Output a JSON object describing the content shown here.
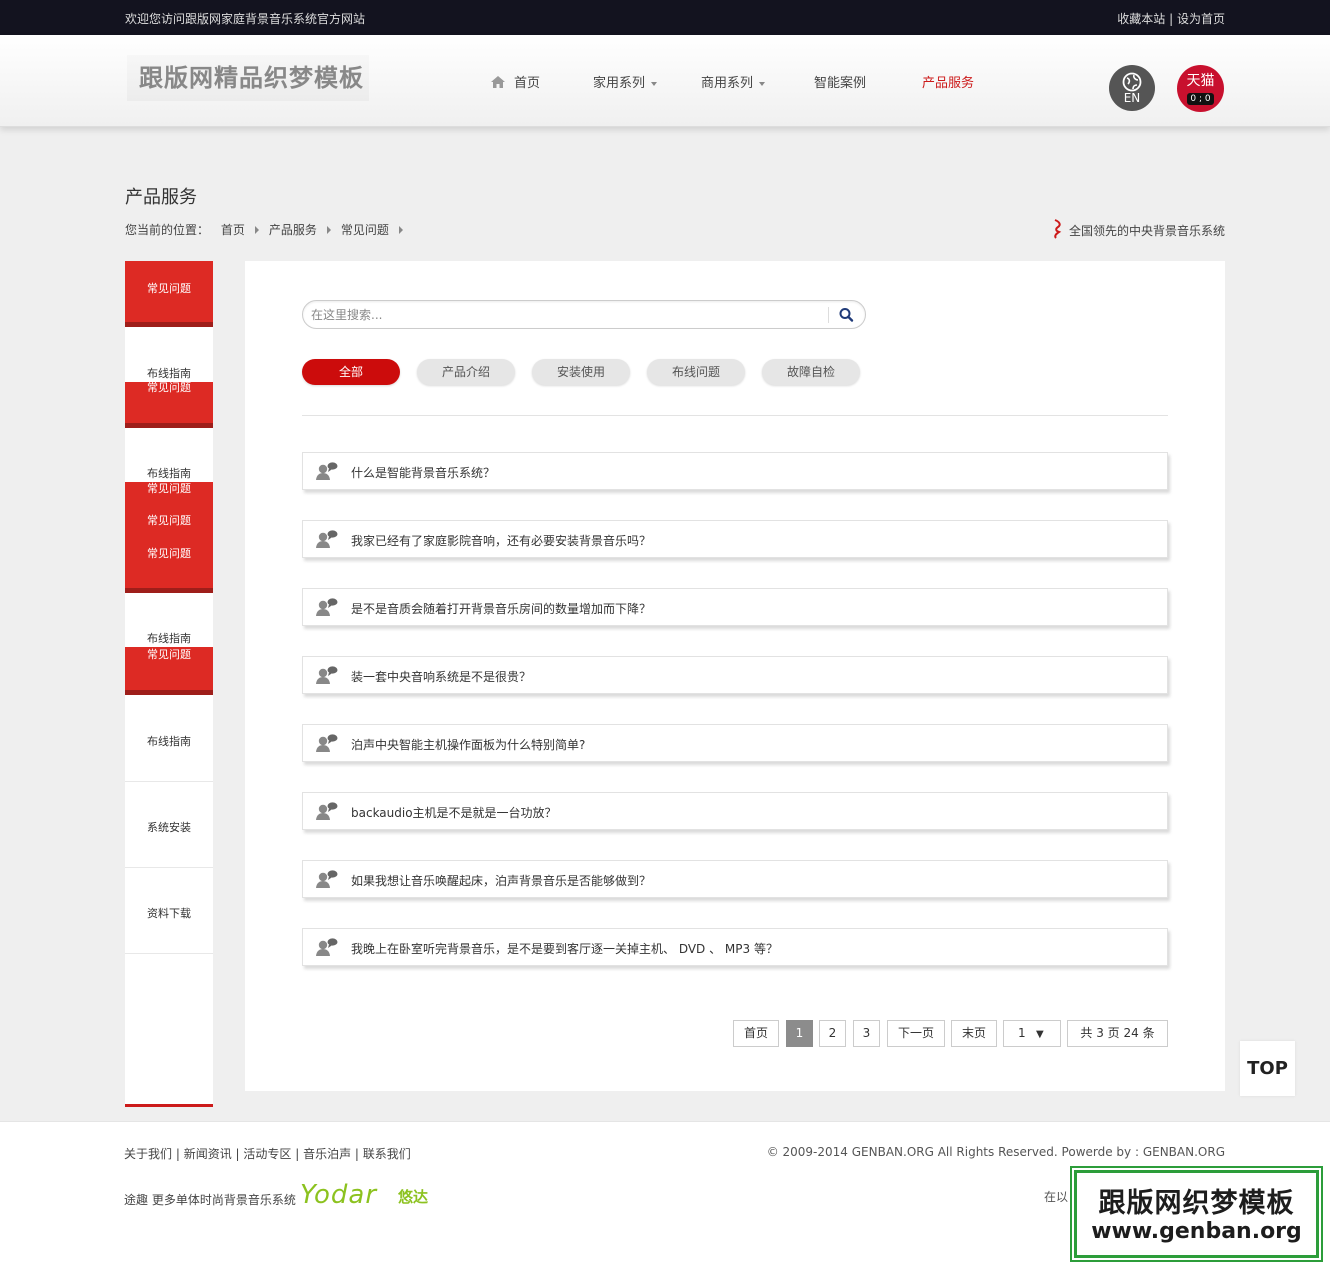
{
  "topbar": {
    "welcome": "欢迎您访问跟版网家庭背景音乐系统官方网站",
    "bookmark": "收藏本站",
    "separator": "|",
    "set_home": "设为首页"
  },
  "header": {
    "logo_text": "跟版网精品织梦模板",
    "nav": [
      {
        "label": "首页"
      },
      {
        "label": "家用系列"
      },
      {
        "label": "商用系列"
      },
      {
        "label": "智能案例"
      },
      {
        "label": "产品服务"
      }
    ],
    "lang_label": "EN",
    "tmall_label": "天猫",
    "tmall_face": "0 ; 0"
  },
  "page": {
    "title": "产品服务",
    "breadcrumb_prefix": "您当前的位置：",
    "breadcrumb": [
      "首页",
      "产品服务",
      "常见问题"
    ],
    "slogan": "全国领先的中央背景音乐系统"
  },
  "sidebar": {
    "items": [
      "常见问题",
      "布线指南",
      "常见问题",
      "布线指南",
      "常见问题",
      "常见问题",
      "常见问题",
      "布线指南",
      "常见问题",
      "布线指南",
      "系统安装",
      "资料下载"
    ]
  },
  "search": {
    "placeholder": "在这里搜索..."
  },
  "filters": [
    "全部",
    "产品介绍",
    "安装使用",
    "布线问题",
    "故障自检"
  ],
  "faqs": [
    "什么是智能背景音乐系统？",
    "我家已经有了家庭影院音响，还有必要安装背景音乐吗？",
    "是不是音质会随着打开背景音乐房间的数量增加而下降？",
    "装一套中央音响系统是不是很贵？",
    "泊声中央智能主机操作面板为什么特别简单?",
    "backaudio主机是不是就是一台功放？",
    "如果我想让音乐唤醒起床，泊声背景音乐是否能够做到？",
    "我晚上在卧室听完背景音乐，是不是要到客厅逐一关掉主机、 DVD 、 MP3 等？"
  ],
  "pager": {
    "first": "首页",
    "pages": [
      "1",
      "2",
      "3"
    ],
    "next": "下一页",
    "last": "末页",
    "select_value": "1",
    "summary": "共 3 页 24 条"
  },
  "top_button": "TOP",
  "footer": {
    "links": [
      "关于我们",
      "新闻资讯",
      "活动专区",
      "音乐泊声",
      "联系我们"
    ],
    "copyright": "© 2009-2014 GENBAN.ORG All Rights Reserved. Powerde by : GENBAN.ORG",
    "promo": "途趣 更多单体时尚背景音乐系统",
    "yodar_logo": "Yodar",
    "yodar_cn": "悠达",
    "cut_text": "在以"
  },
  "watermark": {
    "line1": "跟版网织梦模板",
    "line2": "www.genban.org"
  },
  "colors": {
    "accent": "#cc1a1a",
    "sidebar_red": "#dd2a24",
    "topbar_bg": "#13131f",
    "pager_current": "#8c8c8c",
    "watermark_green": "#2c9d3a",
    "yodar_green": "#8cc21f"
  }
}
